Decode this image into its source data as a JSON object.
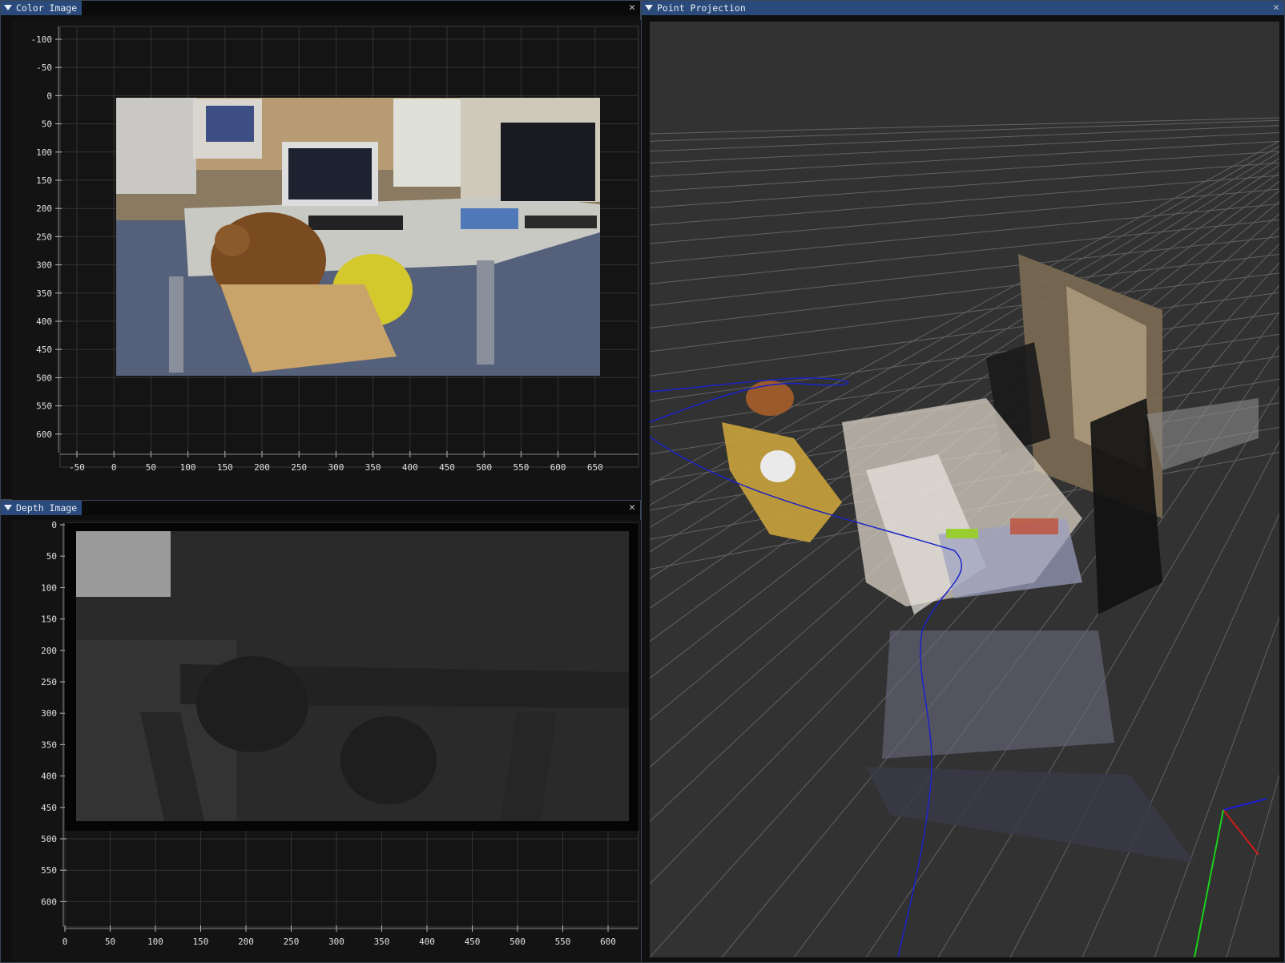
{
  "color_window": {
    "title": "Color Image",
    "close_glyph": "✕",
    "y_ticks": [
      "-100",
      "-50",
      "0",
      "50",
      "100",
      "150",
      "200",
      "250",
      "300",
      "350",
      "400",
      "450",
      "500",
      "550",
      "600"
    ],
    "x_ticks": [
      "-50",
      "0",
      "50",
      "100",
      "150",
      "200",
      "250",
      "300",
      "350",
      "400",
      "450",
      "500",
      "550",
      "600",
      "650"
    ]
  },
  "depth_window": {
    "title": "Depth Image",
    "close_glyph": "✕",
    "y_ticks": [
      "0",
      "50",
      "100",
      "150",
      "200",
      "250",
      "300",
      "350",
      "400",
      "450",
      "500",
      "550",
      "600"
    ],
    "x_ticks": [
      "0",
      "50",
      "100",
      "150",
      "200",
      "250",
      "300",
      "350",
      "400",
      "450",
      "500",
      "550",
      "600"
    ]
  },
  "point_window": {
    "title": "Point Projection",
    "close_glyph": "✕"
  },
  "colors": {
    "title_active": "#294a7a",
    "grid": "#3c3c3c",
    "viewport_bg": "#323232",
    "axis_x": "#d11a1a",
    "axis_y": "#1ad11a",
    "axis_z": "#1a1ad1",
    "trajectory": "#1a22c8"
  }
}
